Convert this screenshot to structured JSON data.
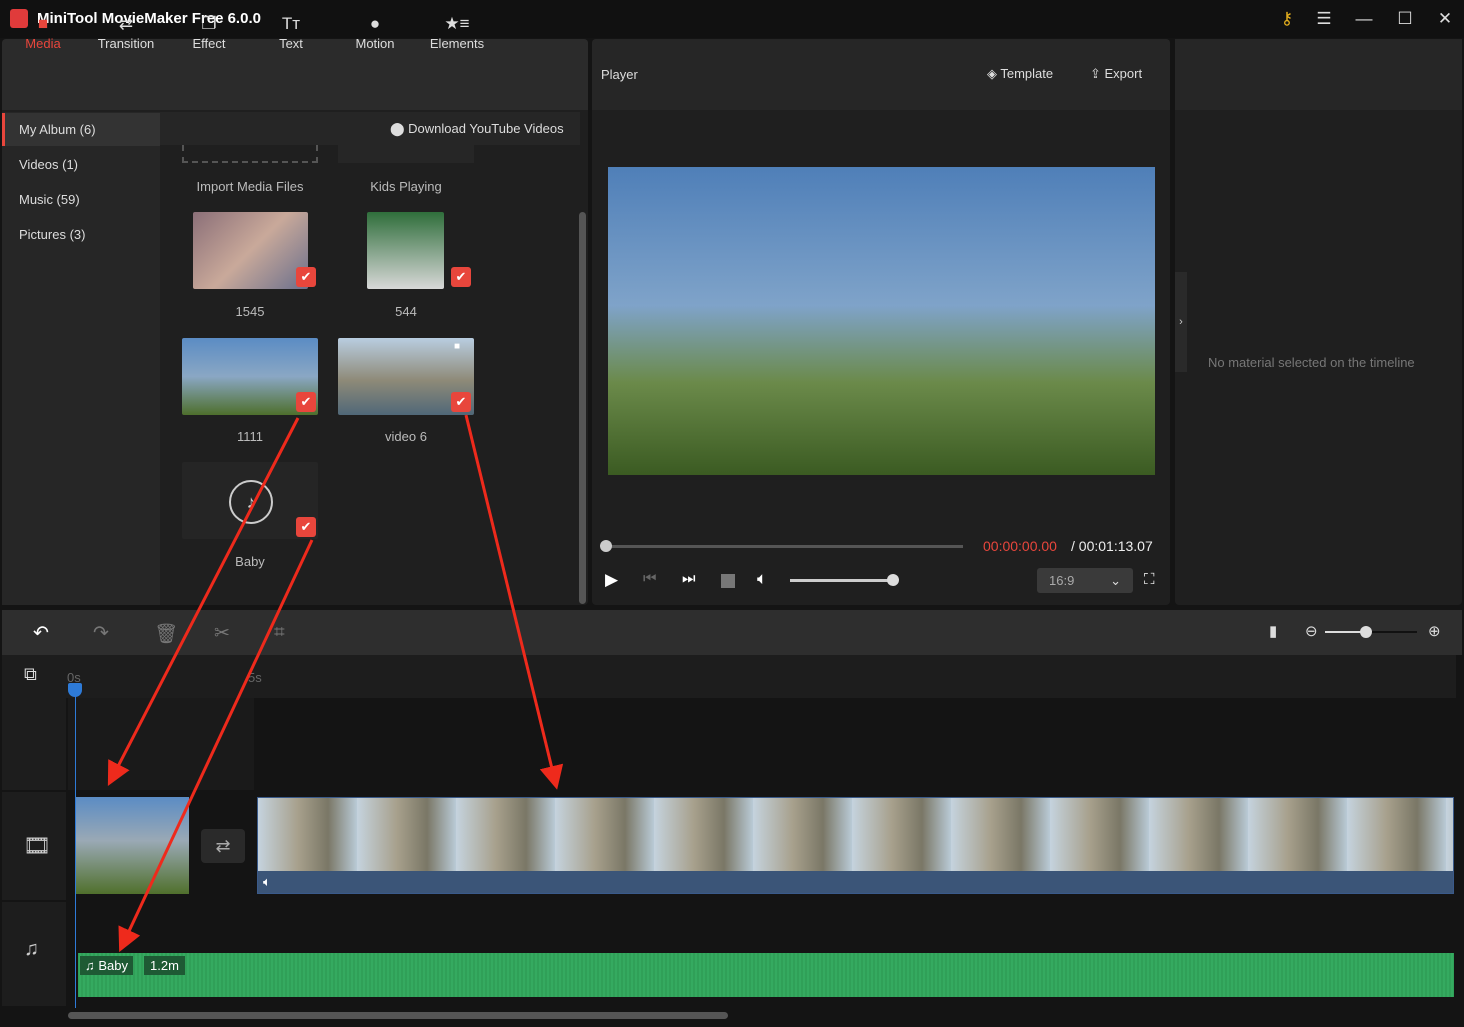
{
  "app": {
    "title": "MiniTool MovieMaker Free 6.0.0"
  },
  "window": {
    "icons": [
      "key-icon",
      "menu-icon",
      "minimize-icon",
      "maximize-icon",
      "close-icon"
    ]
  },
  "toolbar": {
    "items": [
      {
        "label": "Media",
        "icon": "folder-icon",
        "active": true
      },
      {
        "label": "Transition",
        "icon": "swap-icon"
      },
      {
        "label": "Effect",
        "icon": "layers-icon"
      },
      {
        "label": "Text",
        "icon": "text-icon"
      },
      {
        "label": "Motion",
        "icon": "motion-icon"
      },
      {
        "label": "Elements",
        "icon": "star-list-icon"
      }
    ]
  },
  "sidebar": {
    "items": [
      {
        "label": "My Album (6)",
        "active": true
      },
      {
        "label": "Videos (1)"
      },
      {
        "label": "Music (59)"
      },
      {
        "label": "Pictures (3)"
      }
    ]
  },
  "media": {
    "download_label": "Download YouTube Videos",
    "items": [
      {
        "label": "Import Media Files"
      },
      {
        "label": "Kids Playing"
      },
      {
        "label": "1545"
      },
      {
        "label": "544"
      },
      {
        "label": "1111"
      },
      {
        "label": "video 6"
      },
      {
        "label": "Baby"
      }
    ]
  },
  "player": {
    "title": "Player",
    "template_label": "Template",
    "export_label": "Export",
    "current_time": "00:00:00.00",
    "total_time": "/ 00:01:13.07",
    "aspect": "16:9",
    "progress": 0,
    "volume": 1.0,
    "accent": "#e8463c"
  },
  "properties": {
    "empty_text": "No material selected on the timeline"
  },
  "timeline": {
    "ruler": [
      "0s",
      "5s"
    ],
    "zoom": 0.45,
    "audio_clip": {
      "name": "Baby",
      "duration": "1.2m"
    },
    "audio_color": "#2e9a55"
  }
}
